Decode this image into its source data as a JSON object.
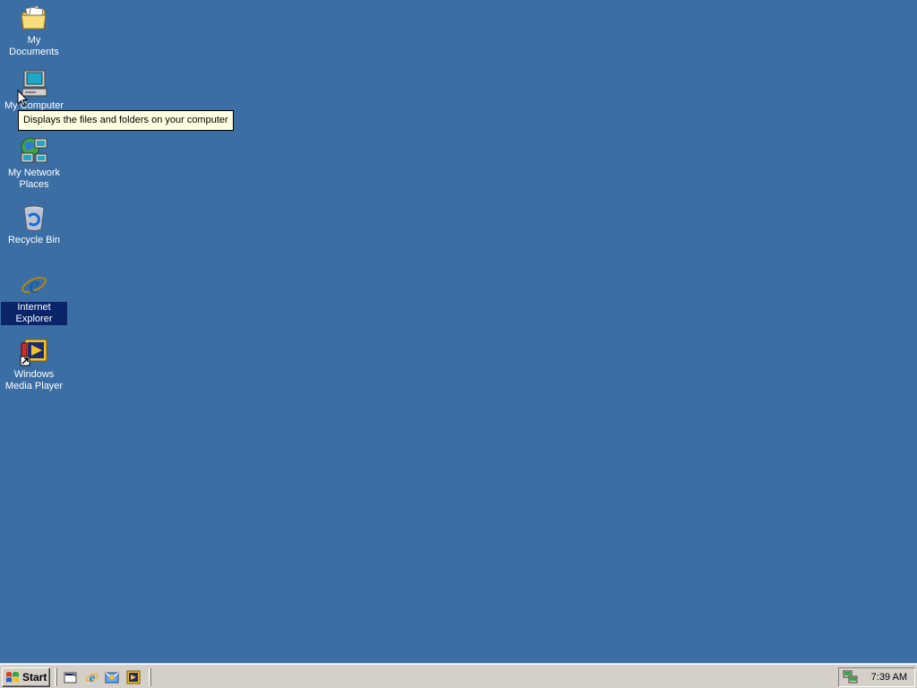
{
  "desktop": {
    "background": "#3a6ea5",
    "icons": [
      {
        "label": "My Documents",
        "icon": "folder-documents-icon"
      },
      {
        "label": "My Computer",
        "icon": "computer-icon"
      },
      {
        "label": "My Network Places",
        "icon": "network-places-icon"
      },
      {
        "label": "Recycle Bin",
        "icon": "recycle-bin-icon"
      },
      {
        "label": "Internet Explorer",
        "icon": "internet-explorer-icon",
        "selected": true
      },
      {
        "label": "Windows Media Player",
        "icon": "media-player-icon",
        "shortcut": true
      }
    ],
    "tooltip": "Displays the files and folders on your computer"
  },
  "taskbar": {
    "start_label": "Start",
    "quick_launch": [
      "show-desktop-icon",
      "internet-explorer-icon",
      "outlook-express-icon",
      "media-player-icon"
    ],
    "tray_icons": [
      "network-connection-icon"
    ],
    "clock": "7:39 AM",
    "color": "#d4d0c8"
  }
}
